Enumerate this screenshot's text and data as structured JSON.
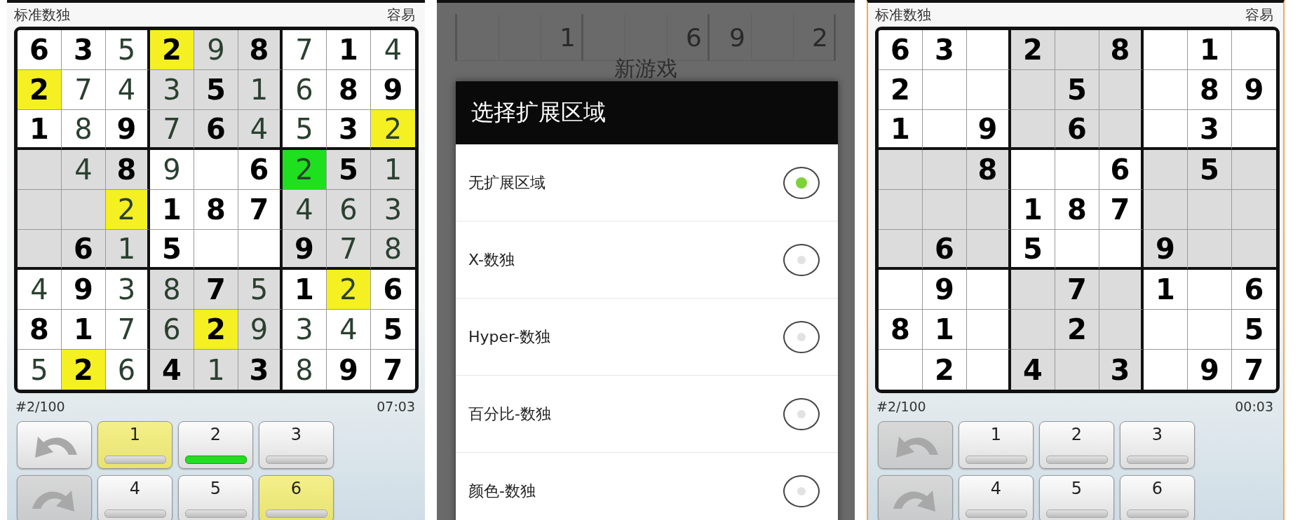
{
  "screens": [
    {
      "kind": "game",
      "title": "标准数独",
      "difficulty": "容易",
      "grid": [
        [
          {
            "value": "6",
            "given": true,
            "selected": false,
            "highlighted": false
          },
          {
            "value": "3",
            "given": true,
            "selected": false,
            "highlighted": false
          },
          {
            "value": "5",
            "given": false,
            "selected": false,
            "highlighted": false
          },
          {
            "value": "2",
            "given": true,
            "selected": false,
            "highlighted": true
          },
          {
            "value": "9",
            "given": false,
            "selected": false,
            "highlighted": false
          },
          {
            "value": "8",
            "given": true,
            "selected": false,
            "highlighted": false
          },
          {
            "value": "7",
            "given": false,
            "selected": false,
            "highlighted": false
          },
          {
            "value": "1",
            "given": true,
            "selected": false,
            "highlighted": false
          },
          {
            "value": "4",
            "given": false,
            "selected": false,
            "highlighted": false
          }
        ],
        [
          {
            "value": "2",
            "given": true,
            "selected": false,
            "highlighted": true
          },
          {
            "value": "7",
            "given": false,
            "selected": false,
            "highlighted": false
          },
          {
            "value": "4",
            "given": false,
            "selected": false,
            "highlighted": false
          },
          {
            "value": "3",
            "given": false,
            "selected": false,
            "highlighted": false
          },
          {
            "value": "5",
            "given": true,
            "selected": false,
            "highlighted": false
          },
          {
            "value": "1",
            "given": false,
            "selected": false,
            "highlighted": false
          },
          {
            "value": "6",
            "given": false,
            "selected": false,
            "highlighted": false
          },
          {
            "value": "8",
            "given": true,
            "selected": false,
            "highlighted": false
          },
          {
            "value": "9",
            "given": true,
            "selected": false,
            "highlighted": false
          }
        ],
        [
          {
            "value": "1",
            "given": true,
            "selected": false,
            "highlighted": false
          },
          {
            "value": "8",
            "given": false,
            "selected": false,
            "highlighted": false
          },
          {
            "value": "9",
            "given": true,
            "selected": false,
            "highlighted": false
          },
          {
            "value": "7",
            "given": false,
            "selected": false,
            "highlighted": false
          },
          {
            "value": "6",
            "given": true,
            "selected": false,
            "highlighted": false
          },
          {
            "value": "4",
            "given": false,
            "selected": false,
            "highlighted": false
          },
          {
            "value": "5",
            "given": false,
            "selected": false,
            "highlighted": false
          },
          {
            "value": "3",
            "given": true,
            "selected": false,
            "highlighted": false
          },
          {
            "value": "2",
            "given": false,
            "selected": false,
            "highlighted": true
          }
        ],
        [
          {
            "selected": false,
            "highlighted": false
          },
          {
            "value": "4",
            "given": false,
            "selected": false,
            "highlighted": false
          },
          {
            "value": "8",
            "given": true,
            "selected": false,
            "highlighted": false
          },
          {
            "value": "9",
            "given": false,
            "selected": false,
            "highlighted": false
          },
          {
            "selected": false,
            "highlighted": false
          },
          {
            "value": "6",
            "given": true,
            "selected": false,
            "highlighted": false
          },
          {
            "value": "2",
            "given": false,
            "selected": true,
            "highlighted": false
          },
          {
            "value": "5",
            "given": true,
            "selected": false,
            "highlighted": false
          },
          {
            "value": "1",
            "given": false,
            "selected": false,
            "highlighted": false
          }
        ],
        [
          {
            "selected": false,
            "highlighted": false
          },
          {
            "selected": false,
            "highlighted": false
          },
          {
            "value": "2",
            "given": false,
            "selected": false,
            "highlighted": true
          },
          {
            "value": "1",
            "given": true,
            "selected": false,
            "highlighted": false
          },
          {
            "value": "8",
            "given": true,
            "selected": false,
            "highlighted": false
          },
          {
            "value": "7",
            "given": true,
            "selected": false,
            "highlighted": false
          },
          {
            "value": "4",
            "given": false,
            "selected": false,
            "highlighted": false
          },
          {
            "value": "6",
            "given": false,
            "selected": false,
            "highlighted": false
          },
          {
            "value": "3",
            "given": false,
            "selected": false,
            "highlighted": false
          }
        ],
        [
          {
            "selected": false,
            "highlighted": false
          },
          {
            "value": "6",
            "given": true,
            "selected": false,
            "highlighted": false
          },
          {
            "value": "1",
            "given": false,
            "selected": false,
            "highlighted": false
          },
          {
            "value": "5",
            "given": true,
            "selected": false,
            "highlighted": false
          },
          {
            "selected": false,
            "highlighted": false
          },
          {
            "selected": false,
            "highlighted": false
          },
          {
            "value": "9",
            "given": true,
            "selected": false,
            "highlighted": false
          },
          {
            "value": "7",
            "given": false,
            "selected": false,
            "highlighted": false
          },
          {
            "value": "8",
            "given": false,
            "selected": false,
            "highlighted": false
          }
        ],
        [
          {
            "value": "4",
            "given": false,
            "selected": false,
            "highlighted": false
          },
          {
            "value": "9",
            "given": true,
            "selected": false,
            "highlighted": false
          },
          {
            "value": "3",
            "given": false,
            "selected": false,
            "highlighted": false
          },
          {
            "value": "8",
            "given": false,
            "selected": false,
            "highlighted": false
          },
          {
            "value": "7",
            "given": true,
            "selected": false,
            "highlighted": false
          },
          {
            "value": "5",
            "given": false,
            "selected": false,
            "highlighted": false
          },
          {
            "value": "1",
            "given": true,
            "selected": false,
            "highlighted": false
          },
          {
            "value": "2",
            "given": false,
            "selected": false,
            "highlighted": true
          },
          {
            "value": "6",
            "given": true,
            "selected": false,
            "highlighted": false
          }
        ],
        [
          {
            "value": "8",
            "given": true,
            "selected": false,
            "highlighted": false
          },
          {
            "value": "1",
            "given": true,
            "selected": false,
            "highlighted": false
          },
          {
            "value": "7",
            "given": false,
            "selected": false,
            "highlighted": false
          },
          {
            "value": "6",
            "given": false,
            "selected": false,
            "highlighted": false
          },
          {
            "value": "2",
            "given": true,
            "selected": false,
            "highlighted": true
          },
          {
            "value": "9",
            "given": false,
            "selected": false,
            "highlighted": false
          },
          {
            "value": "3",
            "given": false,
            "selected": false,
            "highlighted": false
          },
          {
            "value": "4",
            "given": false,
            "selected": false,
            "highlighted": false
          },
          {
            "value": "5",
            "given": true,
            "selected": false,
            "highlighted": false
          }
        ],
        [
          {
            "value": "5",
            "given": false,
            "selected": false,
            "highlighted": false
          },
          {
            "value": "2",
            "given": true,
            "selected": false,
            "highlighted": true
          },
          {
            "value": "6",
            "given": false,
            "selected": false,
            "highlighted": false
          },
          {
            "value": "4",
            "given": true,
            "selected": false,
            "highlighted": false
          },
          {
            "value": "1",
            "given": false,
            "selected": false,
            "highlighted": false
          },
          {
            "value": "3",
            "given": true,
            "selected": false,
            "highlighted": false
          },
          {
            "value": "8",
            "given": false,
            "selected": false,
            "highlighted": false
          },
          {
            "value": "9",
            "given": true,
            "selected": false,
            "highlighted": false
          },
          {
            "value": "7",
            "given": true,
            "selected": false,
            "highlighted": false
          }
        ]
      ],
      "puzzle_number": "#2/100",
      "timer": "07:03",
      "undo": {
        "disabled": false
      },
      "redo": {
        "disabled": true
      },
      "keypad": [
        {
          "label": "1",
          "highlighted": true,
          "selected": false
        },
        {
          "label": "2",
          "highlighted": false,
          "selected": true
        },
        {
          "label": "3",
          "highlighted": false,
          "selected": false
        },
        {
          "label": "4",
          "highlighted": false,
          "selected": false
        },
        {
          "label": "5",
          "highlighted": false,
          "selected": false
        },
        {
          "label": "6",
          "highlighted": true,
          "selected": false
        }
      ]
    },
    {
      "kind": "dialog",
      "background": {
        "title": "新游戏",
        "row": [
          {
            "kind": "blank"
          },
          {
            "kind": "blank"
          },
          {
            "kind": "digit",
            "value": "1"
          },
          {
            "kind": "blank"
          },
          {
            "kind": "blank"
          },
          {
            "kind": "digit",
            "value": "6"
          },
          {
            "kind": "digit",
            "value": "9"
          },
          {
            "kind": "blank"
          },
          {
            "kind": "digit",
            "value": "2"
          }
        ]
      },
      "dialog": {
        "title": "选择扩展区域",
        "options": [
          {
            "label": "无扩展区域",
            "selected": true
          },
          {
            "label": "X-数独",
            "selected": false
          },
          {
            "label": "Hyper-数独",
            "selected": false
          },
          {
            "label": "百分比-数独",
            "selected": false
          },
          {
            "label": "颜色-数独",
            "selected": false
          }
        ]
      }
    },
    {
      "kind": "game",
      "title": "标准数独",
      "difficulty": "容易",
      "grid": [
        [
          {
            "value": "6",
            "given": true,
            "selected": false,
            "highlighted": false
          },
          {
            "value": "3",
            "given": true,
            "selected": false,
            "highlighted": false
          },
          {
            "selected": false,
            "highlighted": false
          },
          {
            "value": "2",
            "given": true,
            "selected": false,
            "highlighted": false
          },
          {
            "selected": false,
            "highlighted": false
          },
          {
            "value": "8",
            "given": true,
            "selected": false,
            "highlighted": false
          },
          {
            "selected": false,
            "highlighted": false
          },
          {
            "value": "1",
            "given": true,
            "selected": false,
            "highlighted": false
          },
          {
            "selected": false,
            "highlighted": false
          }
        ],
        [
          {
            "value": "2",
            "given": true,
            "selected": false,
            "highlighted": false
          },
          {
            "selected": false,
            "highlighted": false
          },
          {
            "selected": false,
            "highlighted": false
          },
          {
            "selected": false,
            "highlighted": false
          },
          {
            "value": "5",
            "given": true,
            "selected": false,
            "highlighted": false
          },
          {
            "selected": false,
            "highlighted": false
          },
          {
            "selected": false,
            "highlighted": false
          },
          {
            "value": "8",
            "given": true,
            "selected": false,
            "highlighted": false
          },
          {
            "value": "9",
            "given": true,
            "selected": false,
            "highlighted": false
          }
        ],
        [
          {
            "value": "1",
            "given": true,
            "selected": false,
            "highlighted": false
          },
          {
            "selected": false,
            "highlighted": false
          },
          {
            "value": "9",
            "given": true,
            "selected": false,
            "highlighted": false
          },
          {
            "selected": false,
            "highlighted": false
          },
          {
            "value": "6",
            "given": true,
            "selected": false,
            "highlighted": false
          },
          {
            "selected": false,
            "highlighted": false
          },
          {
            "selected": false,
            "highlighted": false
          },
          {
            "value": "3",
            "given": true,
            "selected": false,
            "highlighted": false
          },
          {
            "selected": false,
            "highlighted": false
          }
        ],
        [
          {
            "selected": false,
            "highlighted": false
          },
          {
            "selected": false,
            "highlighted": false
          },
          {
            "value": "8",
            "given": true,
            "selected": false,
            "highlighted": false
          },
          {
            "selected": false,
            "highlighted": false
          },
          {
            "selected": false,
            "highlighted": false
          },
          {
            "value": "6",
            "given": true,
            "selected": false,
            "highlighted": false
          },
          {
            "selected": false,
            "highlighted": false
          },
          {
            "value": "5",
            "given": true,
            "selected": false,
            "highlighted": false
          },
          {
            "selected": false,
            "highlighted": false
          }
        ],
        [
          {
            "selected": false,
            "highlighted": false
          },
          {
            "selected": false,
            "highlighted": false
          },
          {
            "selected": false,
            "highlighted": false
          },
          {
            "value": "1",
            "given": true,
            "selected": false,
            "highlighted": false
          },
          {
            "value": "8",
            "given": true,
            "selected": false,
            "highlighted": false
          },
          {
            "value": "7",
            "given": true,
            "selected": false,
            "highlighted": false
          },
          {
            "selected": false,
            "highlighted": false
          },
          {
            "selected": false,
            "highlighted": false
          },
          {
            "selected": false,
            "highlighted": false
          }
        ],
        [
          {
            "selected": false,
            "highlighted": false
          },
          {
            "value": "6",
            "given": true,
            "selected": false,
            "highlighted": false
          },
          {
            "selected": false,
            "highlighted": false
          },
          {
            "value": "5",
            "given": true,
            "selected": false,
            "highlighted": false
          },
          {
            "selected": false,
            "highlighted": false
          },
          {
            "selected": false,
            "highlighted": false
          },
          {
            "value": "9",
            "given": true,
            "selected": false,
            "highlighted": false
          },
          {
            "selected": false,
            "highlighted": false
          },
          {
            "selected": false,
            "highlighted": false
          }
        ],
        [
          {
            "selected": false,
            "highlighted": false
          },
          {
            "value": "9",
            "given": true,
            "selected": false,
            "highlighted": false
          },
          {
            "selected": false,
            "highlighted": false
          },
          {
            "selected": false,
            "highlighted": false
          },
          {
            "value": "7",
            "given": true,
            "selected": false,
            "highlighted": false
          },
          {
            "selected": false,
            "highlighted": false
          },
          {
            "value": "1",
            "given": true,
            "selected": false,
            "highlighted": false
          },
          {
            "selected": false,
            "highlighted": false
          },
          {
            "value": "6",
            "given": true,
            "selected": false,
            "highlighted": false
          }
        ],
        [
          {
            "value": "8",
            "given": true,
            "selected": false,
            "highlighted": false
          },
          {
            "value": "1",
            "given": true,
            "selected": false,
            "highlighted": false
          },
          {
            "selected": false,
            "highlighted": false
          },
          {
            "selected": false,
            "highlighted": false
          },
          {
            "value": "2",
            "given": true,
            "selected": false,
            "highlighted": false
          },
          {
            "selected": false,
            "highlighted": false
          },
          {
            "selected": false,
            "highlighted": false
          },
          {
            "selected": false,
            "highlighted": false
          },
          {
            "value": "5",
            "given": true,
            "selected": false,
            "highlighted": false
          }
        ],
        [
          {
            "selected": false,
            "highlighted": false
          },
          {
            "value": "2",
            "given": true,
            "selected": false,
            "highlighted": false
          },
          {
            "selected": false,
            "highlighted": false
          },
          {
            "value": "4",
            "given": true,
            "selected": false,
            "highlighted": false
          },
          {
            "selected": false,
            "highlighted": false
          },
          {
            "value": "3",
            "given": true,
            "selected": false,
            "highlighted": false
          },
          {
            "selected": false,
            "highlighted": false
          },
          {
            "value": "9",
            "given": true,
            "selected": false,
            "highlighted": false
          },
          {
            "value": "7",
            "given": true,
            "selected": false,
            "highlighted": false
          }
        ]
      ],
      "puzzle_number": "#2/100",
      "timer": "00:03",
      "undo": {
        "disabled": true
      },
      "redo": {
        "disabled": true
      },
      "keypad": [
        {
          "label": "1",
          "highlighted": false,
          "selected": false
        },
        {
          "label": "2",
          "highlighted": false,
          "selected": false
        },
        {
          "label": "3",
          "highlighted": false,
          "selected": false
        },
        {
          "label": "4",
          "highlighted": false,
          "selected": false
        },
        {
          "label": "5",
          "highlighted": false,
          "selected": false
        },
        {
          "label": "6",
          "highlighted": false,
          "selected": false
        }
      ]
    }
  ]
}
